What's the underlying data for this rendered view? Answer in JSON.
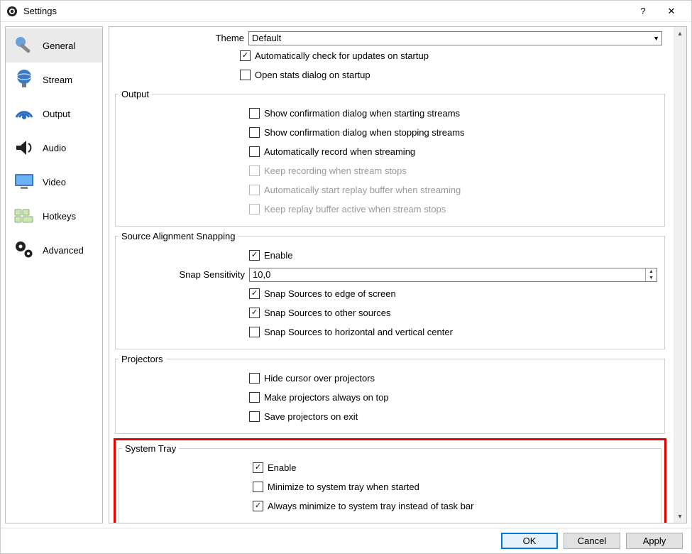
{
  "window": {
    "title": "Settings",
    "help": "?",
    "close": "✕"
  },
  "sidebar": {
    "items": [
      {
        "label": "General"
      },
      {
        "label": "Stream"
      },
      {
        "label": "Output"
      },
      {
        "label": "Audio"
      },
      {
        "label": "Video"
      },
      {
        "label": "Hotkeys"
      },
      {
        "label": "Advanced"
      }
    ]
  },
  "theme": {
    "label": "Theme",
    "value": "Default"
  },
  "general_top": {
    "auto_update": "Automatically check for updates on startup",
    "open_stats": "Open stats dialog on startup"
  },
  "output": {
    "legend": "Output",
    "confirm_start": "Show confirmation dialog when starting streams",
    "confirm_stop": "Show confirmation dialog when stopping streams",
    "auto_record": "Automatically record when streaming",
    "keep_recording": "Keep recording when stream stops",
    "auto_replay": "Automatically start replay buffer when streaming",
    "keep_replay": "Keep replay buffer active when stream stops"
  },
  "snapping": {
    "legend": "Source Alignment Snapping",
    "enable": "Enable",
    "sensitivity_label": "Snap Sensitivity",
    "sensitivity_value": "10,0",
    "edge": "Snap Sources to edge of screen",
    "other": "Snap Sources to other sources",
    "center": "Snap Sources to horizontal and vertical center"
  },
  "projectors": {
    "legend": "Projectors",
    "hide_cursor": "Hide cursor over projectors",
    "on_top": "Make projectors always on top",
    "save": "Save projectors on exit"
  },
  "systray": {
    "legend": "System Tray",
    "enable": "Enable",
    "minimize_start": "Minimize to system tray when started",
    "always_minimize": "Always minimize to system tray instead of task bar"
  },
  "buttons": {
    "ok": "OK",
    "cancel": "Cancel",
    "apply": "Apply"
  }
}
